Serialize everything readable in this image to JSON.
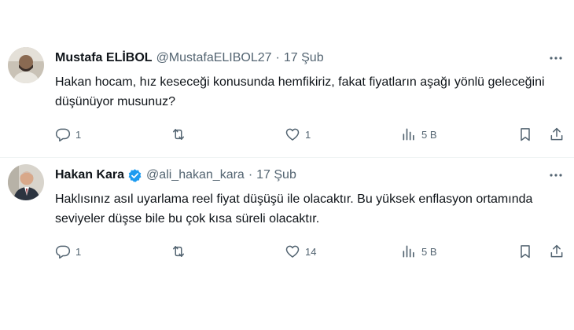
{
  "tweets": [
    {
      "author": "Mustafa ELİBOL",
      "handle": "@MustafaELIBOL27",
      "separator": "·",
      "time": "17 Şub",
      "verified": false,
      "body": "Hakan hocam, hız keseceği konusunda hemfikiriz, fakat fiyatların aşağı yönlü geleceğini düşünüyor musunuz?",
      "replies": "1",
      "retweets": "",
      "likes": "1",
      "views": "5 B",
      "avatar_icon": "person-avatar"
    },
    {
      "author": "Hakan Kara",
      "handle": "@ali_hakan_kara",
      "separator": "·",
      "time": "17 Şub",
      "verified": true,
      "body": "Haklısınız asıl uyarlama reel fiyat düşüşü ile olacaktır. Bu yüksek enflasyon ortamında seviyeler düşse bile bu çok kısa süreli olacaktır.",
      "replies": "1",
      "retweets": "",
      "likes": "14",
      "views": "5 B",
      "avatar_icon": "person-avatar"
    }
  ],
  "colors": {
    "text": "#0f1419",
    "muted": "#536471",
    "verified_blue": "#1d9bf0",
    "divider": "#eff3f4"
  },
  "icons": [
    "reply-icon",
    "retweet-icon",
    "like-icon",
    "views-icon",
    "bookmark-icon",
    "share-icon",
    "more-options-icon",
    "verified-badge-icon"
  ]
}
